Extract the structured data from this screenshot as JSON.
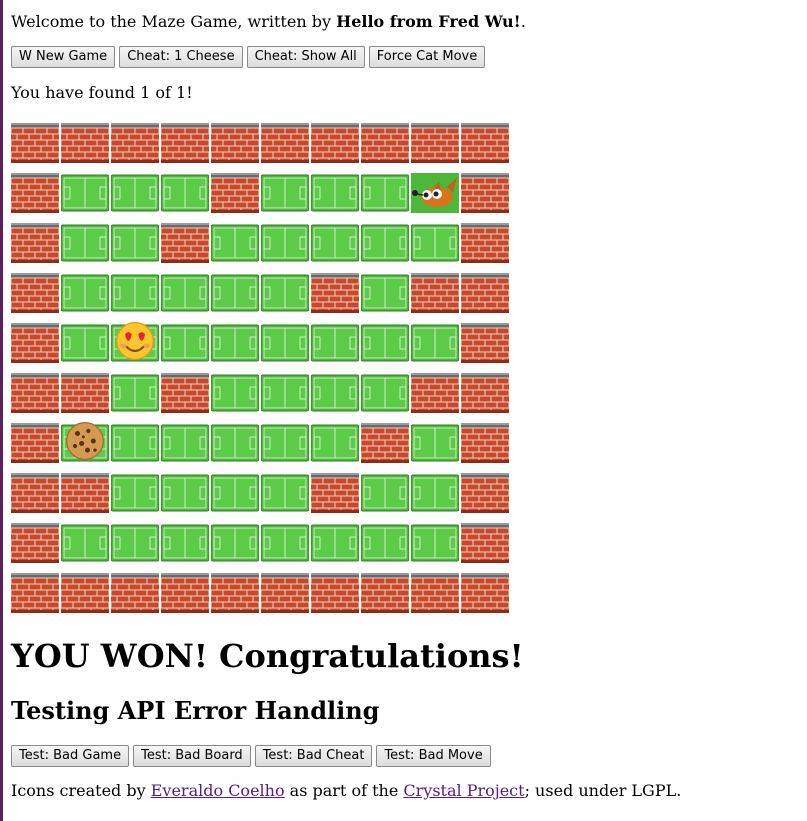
{
  "header": {
    "welcome_text": "Welcome to the Maze Game, written by ",
    "author": "Hello from Fred Wu!",
    "trailing": "."
  },
  "controls": {
    "new_game": "W New Game",
    "cheat_one": "Cheat: 1 Cheese",
    "cheat_all": "Cheat: Show All",
    "force_cat": "Force Cat Move"
  },
  "status": {
    "found_text": "You have found 1 of 1!"
  },
  "maze": {
    "rows": [
      "WWWWWWWWWW",
      "WFFFWFFFCW",
      "WFFWFFFFFW",
      "WFFFFFWFWW",
      "WFMFFFFFFW",
      "WWFWFFFFWW",
      "WKFFFFFWFW",
      "WWFFFFWFFW",
      "WFFFFFFFFW",
      "WWWWWWWWWW"
    ],
    "legend": {
      "W": "brick-wall",
      "F": "grass-floor",
      "C": "cat",
      "M": "mouse",
      "K": "cookie"
    }
  },
  "win_message": "YOU WON! Congratulations!",
  "testing": {
    "heading": "Testing API Error Handling",
    "bad_game": "Test: Bad Game",
    "bad_board": "Test: Bad Board",
    "bad_cheat": "Test: Bad Cheat",
    "bad_move": "Test: Bad Move"
  },
  "credits": {
    "prefix": "Icons created by ",
    "author_link": "Everaldo Coelho",
    "middle": " as part of the ",
    "project_link": "Crystal Project",
    "suffix": "; used under LGPL."
  },
  "colors": {
    "brick": "#c8482a",
    "wall_cap": "#6a6a6a",
    "grass": "#4cb83a",
    "link": "#551a8b"
  }
}
